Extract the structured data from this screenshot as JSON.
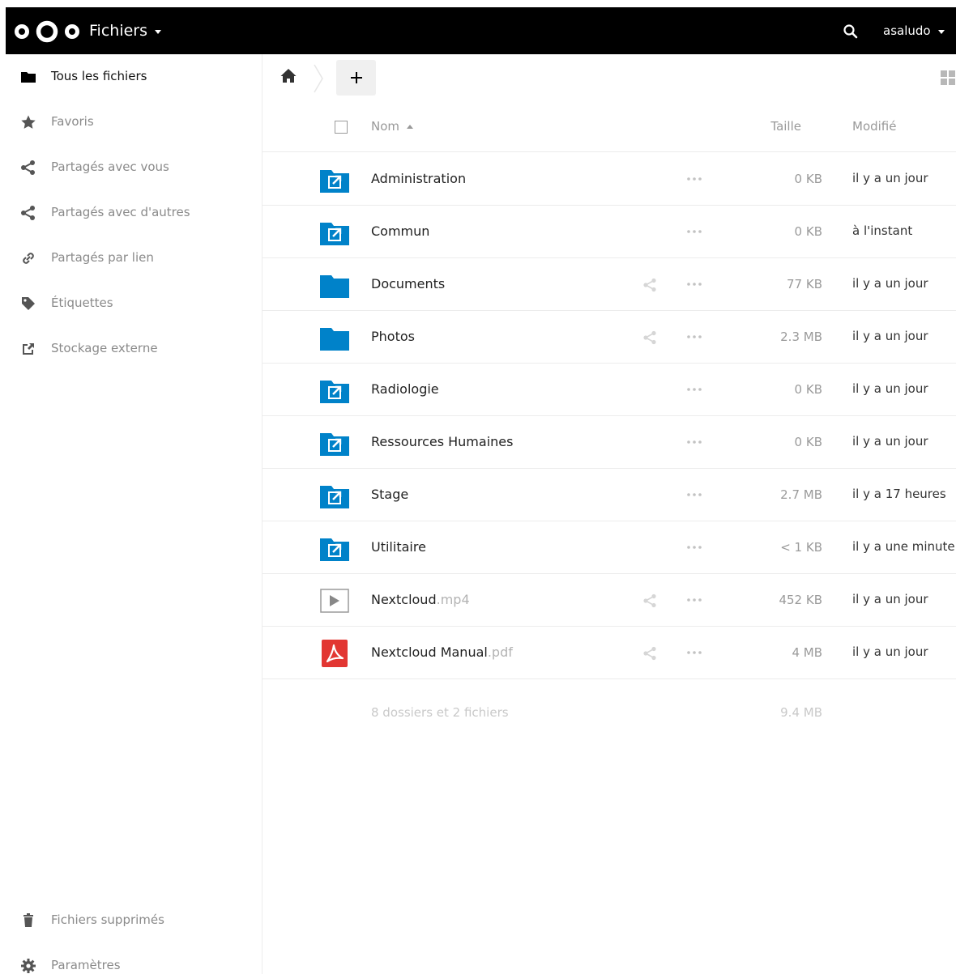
{
  "header": {
    "app_title": "Fichiers",
    "user": "asaludo",
    "logo_icon": "nextcloud-logo",
    "background": "#000000"
  },
  "sidebar": {
    "items": [
      {
        "label": "Tous les fichiers",
        "icon": "folder-icon",
        "active": true
      },
      {
        "label": "Favoris",
        "icon": "star-icon"
      },
      {
        "label": "Partagés avec vous",
        "icon": "share-icon"
      },
      {
        "label": "Partagés avec d'autres",
        "icon": "share-icon"
      },
      {
        "label": "Partagés par lien",
        "icon": "link-icon"
      },
      {
        "label": "Étiquettes",
        "icon": "tag-icon"
      },
      {
        "label": "Stockage externe",
        "icon": "external-icon"
      }
    ],
    "bottom": [
      {
        "label": "Fichiers supprimés",
        "icon": "trash-icon"
      },
      {
        "label": "Paramètres",
        "icon": "gear-icon"
      }
    ]
  },
  "toolbar": {
    "new_label": "+"
  },
  "table": {
    "headers": {
      "name": "Nom",
      "size": "Taille",
      "modified": "Modifié"
    },
    "rows": [
      {
        "name": "Administration",
        "ext": "",
        "type": "external-folder",
        "shared": false,
        "size": "0 KB",
        "modified": "il y a un jour"
      },
      {
        "name": "Commun",
        "ext": "",
        "type": "external-folder",
        "shared": false,
        "size": "0 KB",
        "modified": "à l'instant"
      },
      {
        "name": "Documents",
        "ext": "",
        "type": "folder",
        "shared": true,
        "size": "77 KB",
        "modified": "il y a un jour"
      },
      {
        "name": "Photos",
        "ext": "",
        "type": "folder",
        "shared": true,
        "size": "2.3 MB",
        "modified": "il y a un jour"
      },
      {
        "name": "Radiologie",
        "ext": "",
        "type": "external-folder",
        "shared": false,
        "size": "0 KB",
        "modified": "il y a un jour"
      },
      {
        "name": "Ressources Humaines",
        "ext": "",
        "type": "external-folder",
        "shared": false,
        "size": "0 KB",
        "modified": "il y a un jour"
      },
      {
        "name": "Stage",
        "ext": "",
        "type": "external-folder",
        "shared": false,
        "size": "2.7 MB",
        "modified": "il y a 17 heures"
      },
      {
        "name": "Utilitaire",
        "ext": "",
        "type": "external-folder",
        "shared": false,
        "size": "< 1 KB",
        "modified": "il y a une minute"
      },
      {
        "name": "Nextcloud",
        "ext": ".mp4",
        "type": "video",
        "shared": true,
        "size": "452 KB",
        "modified": "il y a un jour"
      },
      {
        "name": "Nextcloud Manual",
        "ext": ".pdf",
        "type": "pdf",
        "shared": true,
        "size": "4 MB",
        "modified": "il y a un jour"
      }
    ],
    "summary": {
      "label": "8 dossiers et 2 fichiers",
      "size": "9.4 MB"
    }
  },
  "colors": {
    "folder": "#0082c9",
    "pdf": "#e23632",
    "muted_text": "#999999",
    "divider": "#ececec"
  }
}
